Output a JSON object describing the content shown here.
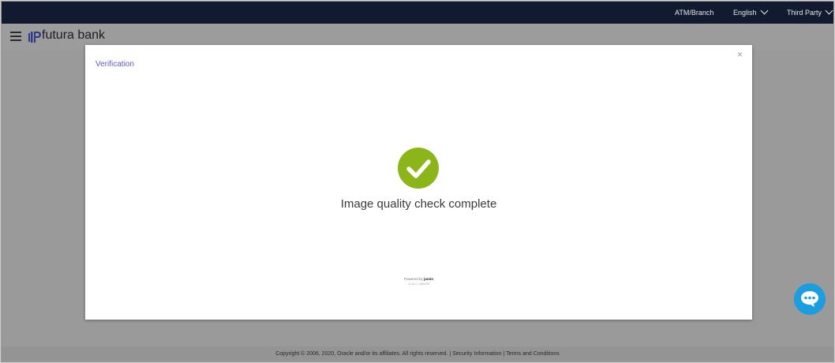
{
  "topbar": {
    "atm_branch": "ATM/Branch",
    "language": "English",
    "third_party": "Third Party"
  },
  "header": {
    "brand_name": "futura bank"
  },
  "modal": {
    "title": "Verification",
    "close_glyph": "×",
    "status": "Image quality check complete",
    "powered_prefix": "Powered by",
    "powered_brand": "jumio",
    "version": "v2.50.1 | 4f8f034f",
    "check_color": "#8cb51a"
  },
  "footer": {
    "copyright": "Copyright © 2006, 2020, Oracle and/or its affiliates. All rights reserved.",
    "security_link": "Security Information",
    "terms_link": "Terms and Conditions",
    "separator": "|"
  },
  "icons": {
    "menu": "hamburger-menu-icon",
    "logo": "futura-bank-logo-icon",
    "check": "check-circle-icon",
    "chat": "chat-bubble-icon"
  },
  "colors": {
    "topbar_bg": "#111a2e",
    "accent_link": "#5a5fc0",
    "chat_fab": "#1a9ee0"
  }
}
